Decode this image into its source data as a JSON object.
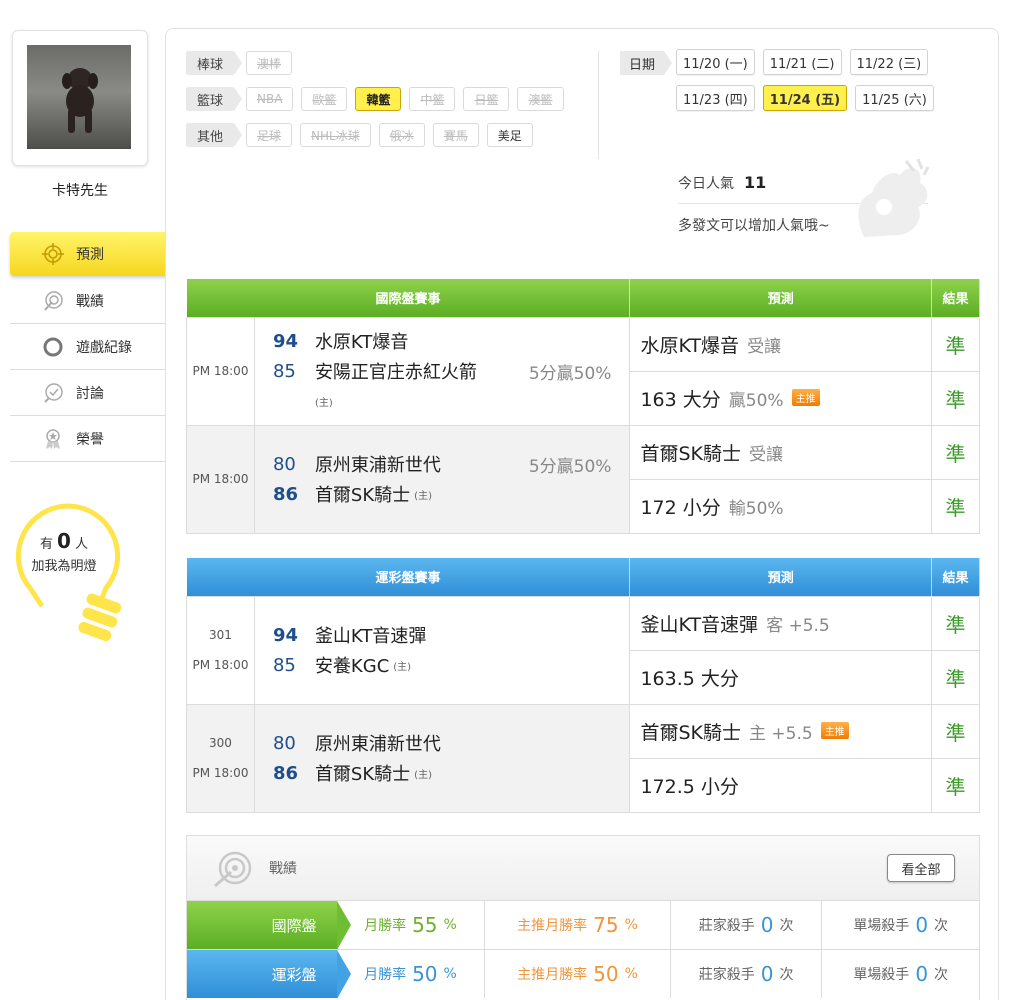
{
  "profile": {
    "username": "卡特先生"
  },
  "nav": [
    {
      "label": "預測",
      "icon": "target-icon",
      "active": true
    },
    {
      "label": "戰績",
      "icon": "trophy-icon"
    },
    {
      "label": "遊戲紀錄",
      "icon": "circle-icon"
    },
    {
      "label": "討論",
      "icon": "chat-icon"
    },
    {
      "label": "榮譽",
      "icon": "medal-icon"
    }
  ],
  "fans": {
    "prefix": "有",
    "count": "0",
    "suffix": "人",
    "line2": "加我為明燈"
  },
  "filters": [
    {
      "category": "棒球",
      "items": [
        {
          "label": "澳棒",
          "state": "disabled"
        }
      ]
    },
    {
      "category": "籃球",
      "items": [
        {
          "label": "NBA",
          "state": "disabled"
        },
        {
          "label": "歐籃",
          "state": "disabled"
        },
        {
          "label": "韓籃",
          "state": "active"
        },
        {
          "label": "中籃",
          "state": "disabled"
        },
        {
          "label": "日籃",
          "state": "disabled"
        },
        {
          "label": "澳籃",
          "state": "disabled"
        }
      ]
    },
    {
      "category": "其他",
      "items": [
        {
          "label": "足球",
          "state": "disabled"
        },
        {
          "label": "NHL冰球",
          "state": "disabled"
        },
        {
          "label": "俄冰",
          "state": "disabled"
        },
        {
          "label": "賽馬",
          "state": "disabled"
        },
        {
          "label": "美足",
          "state": "on"
        }
      ]
    }
  ],
  "dates": {
    "label": "日期",
    "items": [
      {
        "label": "11/20 (一)"
      },
      {
        "label": "11/21 (二)"
      },
      {
        "label": "11/22 (三)"
      },
      {
        "label": "11/23 (四)"
      },
      {
        "label": "11/24 (五)",
        "active": true
      },
      {
        "label": "11/25 (六)"
      }
    ]
  },
  "popularity": {
    "label": "今日人氣",
    "value": "11",
    "hint": "多發文可以增加人氣哦~"
  },
  "intl_table": {
    "headers": [
      "國際盤賽事",
      "預測",
      "結果"
    ],
    "games": [
      {
        "time": "PM 18:00",
        "away": {
          "score": "94",
          "name": "水原KT爆音"
        },
        "home": {
          "score": "85",
          "name": "安陽正官庄赤紅火箭",
          "home_mark": "(主)"
        },
        "handicap": "5分贏50%",
        "predictions": [
          {
            "main": "水原KT爆音",
            "sub": "受讓",
            "badge": "",
            "result": "準"
          },
          {
            "main": "163 大分",
            "sub": "贏50%",
            "badge": "主推",
            "result": "準"
          }
        ]
      },
      {
        "time": "PM 18:00",
        "away": {
          "score": "80",
          "name": "原州東浦新世代"
        },
        "home": {
          "score": "86",
          "name": "首爾SK騎士",
          "home_mark": "(主)"
        },
        "handicap": "5分贏50%",
        "predictions": [
          {
            "main": "首爾SK騎士",
            "sub": "受讓",
            "badge": "",
            "result": "準"
          },
          {
            "main": "172 小分",
            "sub": "輸50%",
            "badge": "",
            "result": "準"
          }
        ]
      }
    ]
  },
  "lottery_table": {
    "headers": [
      "運彩盤賽事",
      "預測",
      "結果"
    ],
    "games": [
      {
        "number": "301",
        "time": "PM 18:00",
        "away": {
          "score": "94",
          "name": "釜山KT音速彈"
        },
        "home": {
          "score": "85",
          "name": "安養KGC",
          "home_mark": "(主)"
        },
        "predictions": [
          {
            "main": "釜山KT音速彈",
            "sub": "客 +5.5",
            "badge": "",
            "result": "準"
          },
          {
            "main": "163.5 大分",
            "sub": "",
            "badge": "",
            "result": "準"
          }
        ]
      },
      {
        "number": "300",
        "time": "PM 18:00",
        "away": {
          "score": "80",
          "name": "原州東浦新世代"
        },
        "home": {
          "score": "86",
          "name": "首爾SK騎士",
          "home_mark": "(主)"
        },
        "predictions": [
          {
            "main": "首爾SK騎士",
            "sub": "主 +5.5",
            "badge": "主推",
            "result": "準"
          },
          {
            "main": "172.5 小分",
            "sub": "",
            "badge": "",
            "result": "準"
          }
        ]
      }
    ]
  },
  "record": {
    "title": "戰績",
    "view_all": "看全部",
    "rows": [
      {
        "label": "國際盤",
        "monthly_label": "月勝率",
        "monthly": "55",
        "pct": "%",
        "top_label": "主推月勝率",
        "top": "75",
        "banker_label": "莊家殺手",
        "banker": "0",
        "times": "次",
        "single_label": "單場殺手",
        "single": "0"
      },
      {
        "label": "運彩盤",
        "monthly_label": "月勝率",
        "monthly": "50",
        "pct": "%",
        "top_label": "主推月勝率",
        "top": "50",
        "banker_label": "莊家殺手",
        "banker": "0",
        "times": "次",
        "single_label": "單場殺手",
        "single": "0"
      }
    ]
  }
}
